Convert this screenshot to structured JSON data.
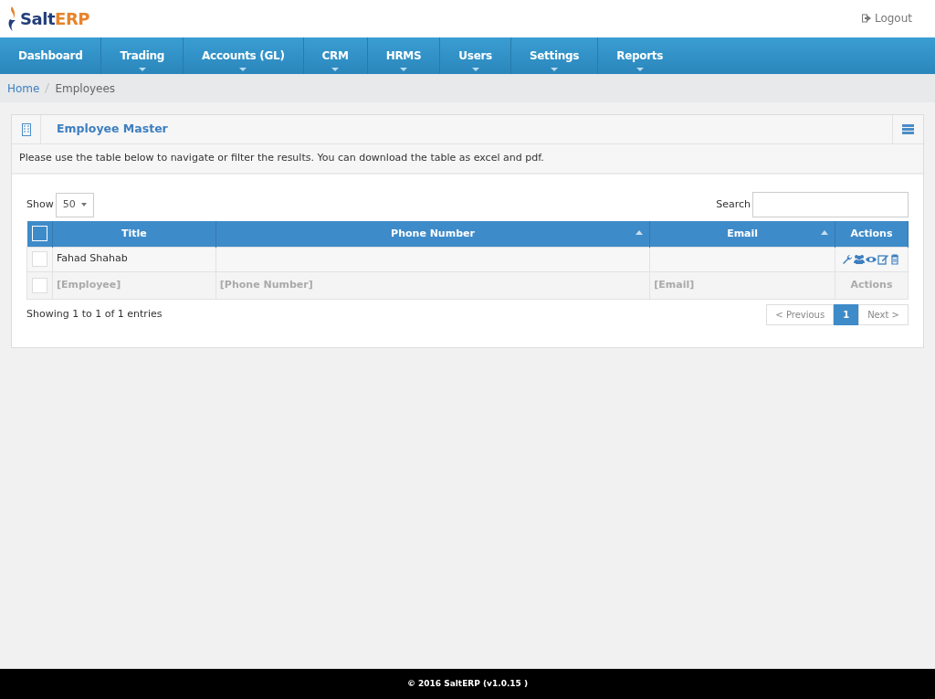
{
  "logo": {
    "part_1": "Salt",
    "part_2": "ERP"
  },
  "logout": "Logout",
  "nav": [
    {
      "label": "Dashboard",
      "dropdown": false
    },
    {
      "label": "Trading",
      "dropdown": true
    },
    {
      "label": "Accounts (GL)",
      "dropdown": true
    },
    {
      "label": "CRM",
      "dropdown": true
    },
    {
      "label": "HRMS",
      "dropdown": true
    },
    {
      "label": "Users",
      "dropdown": true
    },
    {
      "label": "Settings",
      "dropdown": true
    },
    {
      "label": "Reports",
      "dropdown": true
    }
  ],
  "breadcrumb": [
    {
      "label": "Home",
      "link": true
    },
    {
      "label": "Employees",
      "link": false
    }
  ],
  "panel": {
    "title": "Employee Master",
    "description": "Please use the table below to navigate or filter the results. You can download the table as excel and pdf."
  },
  "show": {
    "label": "Show",
    "value": "50"
  },
  "search": {
    "label": "Search"
  },
  "table": {
    "select_all_checked": false,
    "columns": [
      {
        "label": "Title",
        "sortable": false
      },
      {
        "label": "Phone Number",
        "sortable": true
      },
      {
        "label": "Email",
        "sortable": true
      },
      {
        "label": "Actions",
        "sortable": false
      }
    ],
    "rows": [
      {
        "kind": "data",
        "checked": false,
        "cells": [
          "Fahad Shahab",
          "",
          ""
        ]
      },
      {
        "kind": "filter",
        "checked": false,
        "cells": [
          "[Employee]",
          "[Phone Number]",
          "[Email]",
          "Actions"
        ]
      }
    ]
  },
  "info": "Showing 1 to 1 of 1 entries",
  "pagination": [
    {
      "label": "< Previous",
      "selected": false
    },
    {
      "label": "1",
      "selected": true
    },
    {
      "label": "Next >",
      "selected": false
    }
  ],
  "footer": "© 2016 SaltERP (v1.0.15 )"
}
